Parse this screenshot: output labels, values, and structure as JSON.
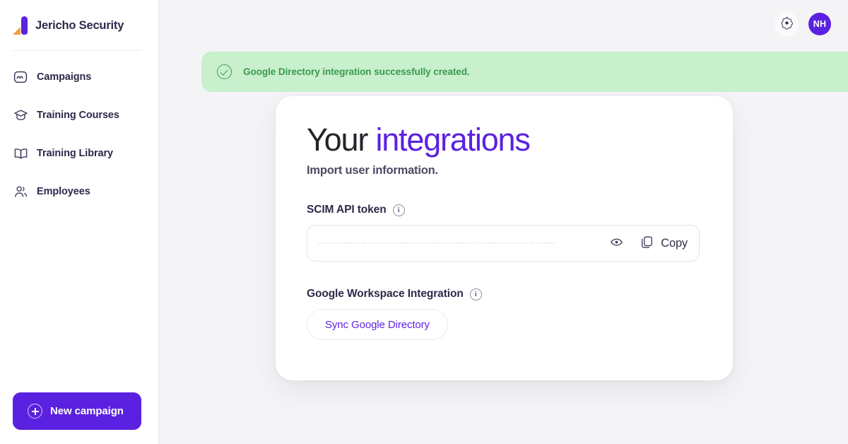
{
  "brand": {
    "name": "Jericho Security",
    "logo_icon": "jericho-logo",
    "colors": {
      "purple": "#5b21e0",
      "orange": "#f2a03d"
    }
  },
  "sidebar": {
    "items": [
      {
        "label": "Campaigns",
        "icon": "campaign-wave-icon"
      },
      {
        "label": "Training Courses",
        "icon": "graduation-cap-icon"
      },
      {
        "label": "Training Library",
        "icon": "open-book-icon"
      },
      {
        "label": "Employees",
        "icon": "people-icon"
      }
    ],
    "cta": {
      "label": "New campaign",
      "icon": "plus-circle-icon"
    }
  },
  "topbar": {
    "settings_icon": "gear-icon",
    "avatar_initials": "NH"
  },
  "toast": {
    "message": "Google Directory integration successfully created.",
    "status_icon": "check-circle-icon",
    "close_icon": "close-icon",
    "close_label": "×",
    "bg_color": "#c8f0cd",
    "text_color": "#3a9a4d"
  },
  "card": {
    "title_plain": "Your ",
    "title_accent": "integrations",
    "subtitle": "Import user information.",
    "scim": {
      "label": "SCIM API token",
      "info_icon": "info-icon",
      "info_glyph": "i",
      "masked_value": "·················································································",
      "placeholder": "",
      "reveal_icon": "eye-icon",
      "copy_icon": "copy-icon",
      "copy_label": "Copy"
    },
    "google": {
      "label": "Google Workspace Integration",
      "info_icon": "info-icon",
      "info_glyph": "i",
      "sync_label": "Sync Google Directory"
    },
    "accent_color": "#5b21e0"
  }
}
